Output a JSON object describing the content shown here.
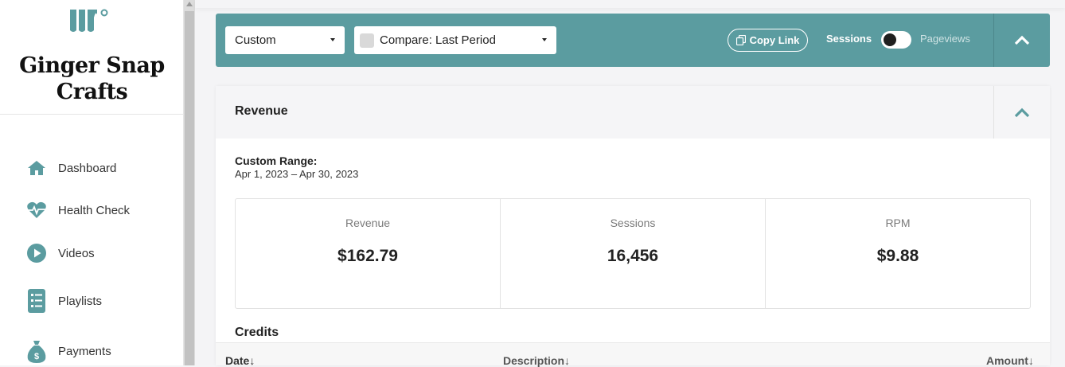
{
  "brand": {
    "name": "Ginger Snap Crafts",
    "logo_icon": "wave-logo-icon"
  },
  "colors": {
    "accent": "#5b9ca0",
    "sidebar_bg": "#ffffff",
    "page_bg": "#f4f4f6"
  },
  "sidebar": {
    "items": [
      {
        "label": "Dashboard",
        "icon": "home-icon"
      },
      {
        "label": "Health Check",
        "icon": "heartbeat-icon"
      },
      {
        "label": "Videos",
        "icon": "play-icon"
      },
      {
        "label": "Playlists",
        "icon": "list-icon"
      },
      {
        "label": "Payments",
        "icon": "money-bag-icon"
      }
    ]
  },
  "toolbar": {
    "range_select": "Custom",
    "compare_select": "Compare: Last Period",
    "copy_link": "Copy Link",
    "toggle_left": "Sessions",
    "toggle_right": "Pageviews"
  },
  "revenue": {
    "title": "Revenue",
    "range_label": "Custom Range:",
    "range_value": "Apr 1, 2023 – Apr 30, 2023",
    "stats": [
      {
        "label": "Revenue",
        "value": "$162.79"
      },
      {
        "label": "Sessions",
        "value": "16,456"
      },
      {
        "label": "RPM",
        "value": "$9.88"
      }
    ],
    "credits_title": "Credits",
    "table_headers": {
      "date": "Date",
      "description": "Description",
      "amount": "Amount"
    }
  }
}
